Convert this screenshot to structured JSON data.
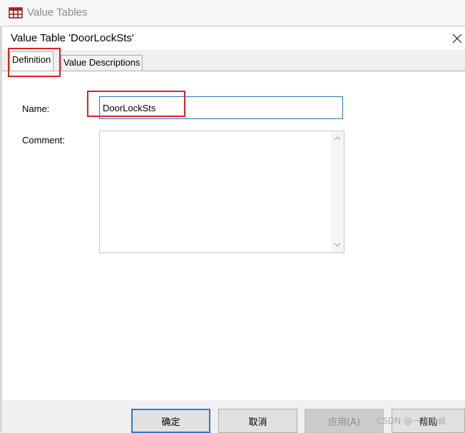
{
  "parent_window": {
    "title": "Value Tables",
    "icon": "table-icon"
  },
  "dialog": {
    "title": "Value Table 'DoorLockSts'",
    "close_icon": "close-icon",
    "tabs": [
      {
        "label": "Definition",
        "active": true
      },
      {
        "label": "Value Descriptions",
        "active": false
      }
    ],
    "fields": {
      "name_label": "Name:",
      "name_value": "DoorLockSts",
      "comment_label": "Comment:",
      "comment_value": ""
    },
    "buttons": {
      "ok": "确定",
      "cancel": "取消",
      "apply": "应用(A)",
      "help": "帮助"
    }
  },
  "watermark": "CSDN @一念赤丝",
  "colors": {
    "annotation": "#e02020",
    "focus_border": "#2b78d6",
    "disabled_text": "#8a8a8a"
  }
}
